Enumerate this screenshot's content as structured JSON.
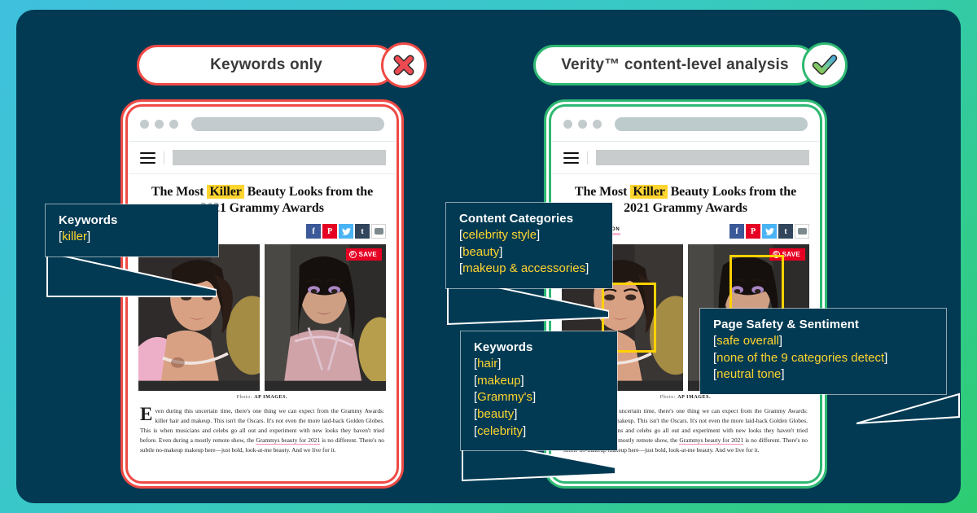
{
  "theme": {
    "bg_gradient_from": "#3fc0dd",
    "bg_gradient_to": "#2ecc71",
    "card_navy": "#023a53",
    "bad_red": "#ef4a45",
    "good_green": "#2eb872",
    "highlight_yellow": "#ffd52e",
    "face_box_yellow": "#ffd100"
  },
  "panels": {
    "left": {
      "title": "Keywords only",
      "status_icon": "cross-icon",
      "status": "bad"
    },
    "right": {
      "title": "Verity™ content-level analysis",
      "status_icon": "check-icon",
      "status": "good"
    }
  },
  "article": {
    "headline_before": "The Most ",
    "headline_highlight": "Killer",
    "headline_after": " Beauty Looks from the 2021 Grammy Awards",
    "byline": "BY SARAH DENTON",
    "photo_credit_label": "Photo:",
    "photo_credit_source": "AP IMAGES.",
    "save_label": "SAVE",
    "share_buttons": [
      {
        "name": "facebook-share-button",
        "glyph": "f"
      },
      {
        "name": "pinterest-share-button",
        "glyph": "P"
      },
      {
        "name": "twitter-share-button",
        "glyph": "❦"
      },
      {
        "name": "tumblr-share-button",
        "glyph": "t"
      },
      {
        "name": "comment-button",
        "glyph": ""
      }
    ],
    "body_dropcap": "E",
    "body_p1": "ven during this uncertain time, there's one thing we can expect from the Grammy Awards: killer hair and makeup. This isn't the Oscars. It's not even the more laid-back Golden Globes. This is when musicians and celebs go all out and experiment with new looks they haven't tried before. Even during a mostly remote show, the ",
    "body_link": "Grammys beauty for 2021",
    "body_p2": " is no different. There's no subtle no-makeup makeup here—just bold, look-at-me beauty. And we live for it."
  },
  "callouts": {
    "left_keywords": {
      "title": "Keywords",
      "items": [
        "killer"
      ]
    },
    "content_categories": {
      "title": "Content Categories",
      "items": [
        "celebrity style",
        "beauty",
        "makeup & accessories"
      ]
    },
    "right_keywords": {
      "title": "Keywords",
      "items": [
        "hair",
        "makeup",
        "Grammy's",
        "beauty",
        "celebrity"
      ]
    },
    "page_safety": {
      "title": "Page Safety & Sentiment",
      "items": [
        "safe overall",
        "none of the 9 categories detect",
        "neutral tone"
      ]
    }
  }
}
